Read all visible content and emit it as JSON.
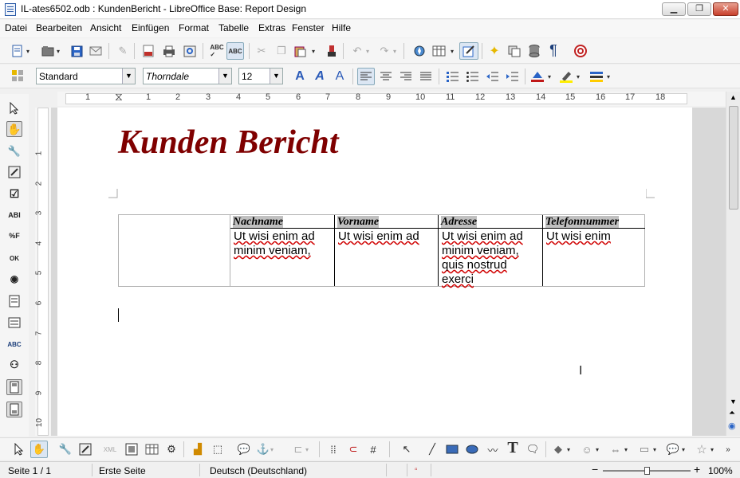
{
  "window": {
    "title": "IL-ates6502.odb : KundenBericht - LibreOffice Base: Report Design",
    "controls": {
      "minimize": "▁",
      "restore": "❐",
      "close": "✕"
    }
  },
  "menu": [
    {
      "label": "Datei"
    },
    {
      "label": "Bearbeiten"
    },
    {
      "label": "Ansicht"
    },
    {
      "label": "Einfügen"
    },
    {
      "label": "Format"
    },
    {
      "label": "Tabelle"
    },
    {
      "label": "Extras"
    },
    {
      "label": "Fenster"
    },
    {
      "label": "Hilfe"
    }
  ],
  "formatting": {
    "paragraph_style": "Standard",
    "font_name": "Thorndale",
    "font_size": "12"
  },
  "ruler": {
    "h_numbers": [
      "1",
      "1",
      "2",
      "3",
      "4",
      "5",
      "6",
      "7",
      "8",
      "9",
      "10",
      "11",
      "12",
      "13",
      "14",
      "15",
      "16",
      "17",
      "18"
    ],
    "v_numbers": [
      "1",
      "2",
      "3",
      "4",
      "5",
      "6",
      "7",
      "8",
      "9",
      "10"
    ]
  },
  "report": {
    "title": "Kunden Bericht",
    "columns": [
      {
        "header": "Nachname",
        "value": "Ut wisi enim ad minim veniam,"
      },
      {
        "header": "Vorname",
        "value": "Ut wisi enim ad"
      },
      {
        "header": "Adresse",
        "value": "Ut wisi enim ad minim veniam, quis nostrud exerci"
      },
      {
        "header": "Telefonnummer",
        "value": "Ut wisi enim"
      }
    ],
    "title_color": "#7f0000"
  },
  "statusbar": {
    "page": "Seite 1 / 1",
    "page_style": "Erste Seite",
    "language": "Deutsch (Deutschland)",
    "zoom": "100%",
    "zoom_out": "−",
    "zoom_in": "+"
  },
  "icons": {
    "standard_toolbar": [
      "new-document-icon",
      "open-icon",
      "save-icon",
      "email-icon",
      "edit-icon",
      "export-pdf-icon",
      "print-icon",
      "print-preview-icon",
      "spellcheck-icon",
      "autospellcheck-icon",
      "cut-icon",
      "copy-icon",
      "paste-icon",
      "clone-formatting-icon",
      "undo-icon",
      "redo-icon",
      "navigator-icon",
      "table-icon",
      "draw-functions-icon",
      "star-icon",
      "gallery-icon",
      "data-sources-icon",
      "formatting-marks-icon",
      "help-icon"
    ]
  }
}
